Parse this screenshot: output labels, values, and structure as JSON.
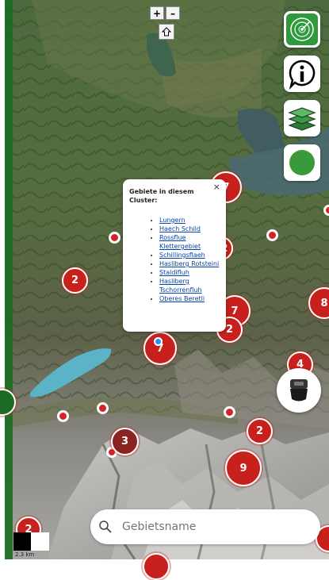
{
  "map": {
    "zoom_in_label": "+",
    "zoom_out_label": "–"
  },
  "tools": [
    {
      "name": "radar-button",
      "icon": "radar-icon"
    },
    {
      "name": "info-button",
      "icon": "info-icon"
    },
    {
      "name": "layers-button",
      "icon": "layers-icon"
    },
    {
      "name": "status-button",
      "icon": "green-circle-icon"
    }
  ],
  "clusters": [
    {
      "label": "7"
    },
    {
      "label": "2"
    },
    {
      "label": "7"
    },
    {
      "label": "2"
    },
    {
      "label": "8"
    },
    {
      "label": "7"
    },
    {
      "label": "4"
    },
    {
      "label": "3"
    },
    {
      "label": "2"
    },
    {
      "label": "9"
    },
    {
      "label": "2"
    },
    {
      "label": "2"
    }
  ],
  "popup": {
    "close_label": "×",
    "title": "Gebiete in diesem Cluster:",
    "items": [
      "Lungern",
      "Haech Schild",
      "Rossflue Klettergebiet",
      "Schillingsflaeh",
      "Hasliberg Rotsteini",
      "Staldifluh",
      "Hasliberg Tschorrenfluh",
      "Oberes Beretli"
    ]
  },
  "search": {
    "placeholder": "Gebietsname"
  },
  "scale": {
    "label": "2.3 km"
  },
  "colors": {
    "cluster": "#c8201c",
    "accent_green": "#3a9a3a",
    "lake": "#5bb3c7"
  }
}
